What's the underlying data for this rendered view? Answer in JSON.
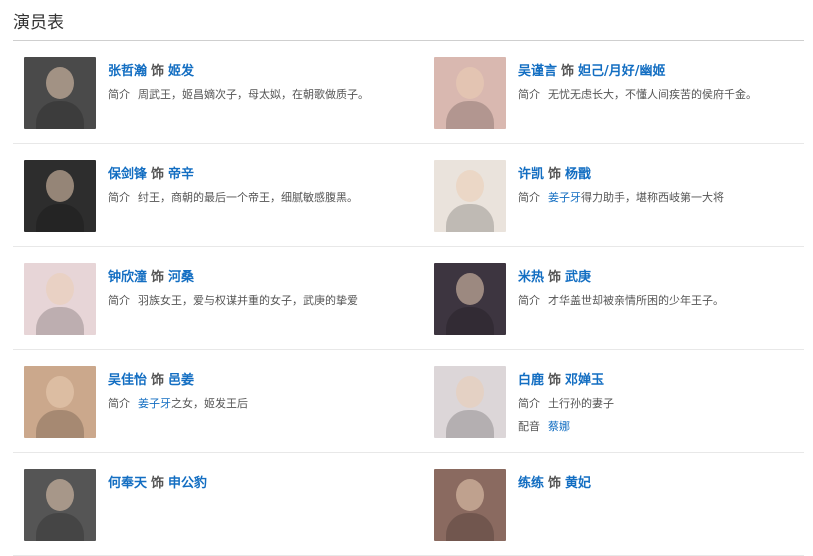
{
  "section": {
    "title": "演员表"
  },
  "connector": "饰",
  "desc_label": "简介",
  "dub_label": "配音",
  "colors": {
    "link": "#136ec2",
    "text": "#555555",
    "divider": "#e8e8e8"
  },
  "rows": [
    [
      {
        "actor": "张哲瀚",
        "role": "姬发",
        "desc_prefix": "",
        "desc_link": "",
        "desc": "周武王，姬昌嫡次子，母太姒，在朝歌做质子。",
        "photo_color": "#4a4a4a",
        "photo_icon": "actor-photo"
      },
      {
        "actor": "吴谨言",
        "role": "妲己/月好/幽姬",
        "desc_prefix": "",
        "desc_link": "",
        "desc": "无忧无虑长大，不懂人间疾苦的侯府千金。",
        "photo_color": "#d9b8b0",
        "photo_icon": "actor-photo"
      }
    ],
    [
      {
        "actor": "保剑锋",
        "role": "帝辛",
        "desc_prefix": "",
        "desc_link": "",
        "desc": "纣王，商朝的最后一个帝王，细腻敏感腹黑。",
        "photo_color": "#2d2d2d",
        "photo_icon": "actor-photo"
      },
      {
        "actor": "许凯",
        "role": "杨戬",
        "desc_prefix": "",
        "desc_link": "姜子牙",
        "desc": "得力助手，堪称西岐第一大将",
        "photo_color": "#eae3dc",
        "photo_icon": "actor-photo"
      }
    ],
    [
      {
        "actor": "钟欣潼",
        "role": "河桑",
        "desc_prefix": "",
        "desc_link": "",
        "desc": "羽族女王，爱与权谋并重的女子，武庚的挚爱",
        "photo_color": "#e7d5d7",
        "photo_icon": "actor-photo"
      },
      {
        "actor": "米热",
        "role": "武庚",
        "desc_prefix": "",
        "desc_link": "",
        "desc": "才华盖世却被亲情所困的少年王子。",
        "photo_color": "#3d3540",
        "photo_icon": "actor-photo"
      }
    ],
    [
      {
        "actor": "吴佳怡",
        "role": "邑姜",
        "desc_prefix": "",
        "desc_link": "姜子牙",
        "desc": "之女，姬发王后",
        "photo_color": "#cba88c",
        "photo_icon": "actor-photo"
      },
      {
        "actor": "白鹿",
        "role": "邓婵玉",
        "desc_prefix": "",
        "desc_link": "",
        "desc": "土行孙的妻子",
        "dub": "蔡娜",
        "photo_color": "#dcd6d8",
        "photo_icon": "actor-photo"
      }
    ],
    [
      {
        "actor": "何奉天",
        "role": "申公豹",
        "desc_prefix": "",
        "desc_link": "",
        "desc": "",
        "photo_color": "#555555",
        "photo_icon": "actor-photo"
      },
      {
        "actor": "练练",
        "role": "黄妃",
        "desc_prefix": "",
        "desc_link": "",
        "desc": "",
        "photo_color": "#8a6a60",
        "photo_icon": "actor-photo"
      }
    ]
  ]
}
